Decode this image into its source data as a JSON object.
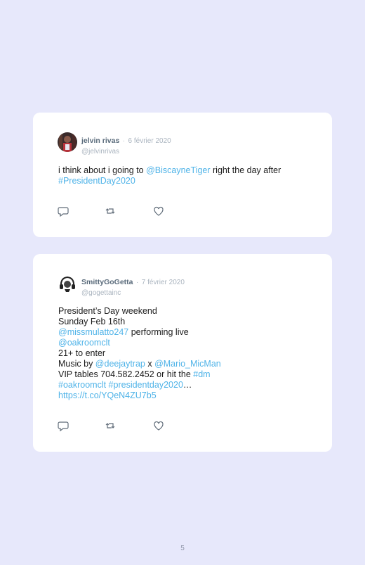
{
  "tweets": [
    {
      "name": "jelvin rivas",
      "separator": "·",
      "date": "6 février 2020",
      "handle": "@jelvinrivas",
      "lines": [
        {
          "a": "i think about i going to ",
          "b": "@BiscayneTiger",
          "c": " right the day after"
        },
        {
          "a": "",
          "b": "#PresidentDay2020",
          "c": ""
        }
      ]
    },
    {
      "name": "SmittyGoGetta",
      "separator": "·",
      "date": "7 février 2020",
      "handle": "@gogettainc",
      "lines": [
        {
          "a": "President’s Day weekend",
          "b": "",
          "c": ""
        },
        {
          "a": "Sunday Feb 16th",
          "b": "",
          "c": ""
        },
        {
          "a": "",
          "b": "@missmulatto247",
          "c": " performing live"
        },
        {
          "a": "",
          "b": "@oakroomclt",
          "c": ""
        },
        {
          "a": "21+ to enter",
          "b": "",
          "c": ""
        },
        {
          "a": "Music by ",
          "b": "@deejaytrap",
          "c": " x ",
          "d": "@Mario_MicMan"
        },
        {
          "a": "VIP tables 704.582.2452 or hit the ",
          "b": "#dm",
          "c": ""
        },
        {
          "a": "",
          "b": "#oakroomclt #presidentday2020",
          "c": "…"
        },
        {
          "a": "",
          "b": "https://t.co/YQeN4ZU7b5",
          "c": ""
        }
      ]
    }
  ],
  "icons": {
    "reply": "reply-icon",
    "retweet": "retweet-icon",
    "like": "heart-icon"
  },
  "colors": {
    "background": "#e7e8fb",
    "card": "#ffffff",
    "link": "#4fb3e8",
    "name": "#5a6b7b",
    "muted": "#aab4bf"
  },
  "page_number": "5"
}
